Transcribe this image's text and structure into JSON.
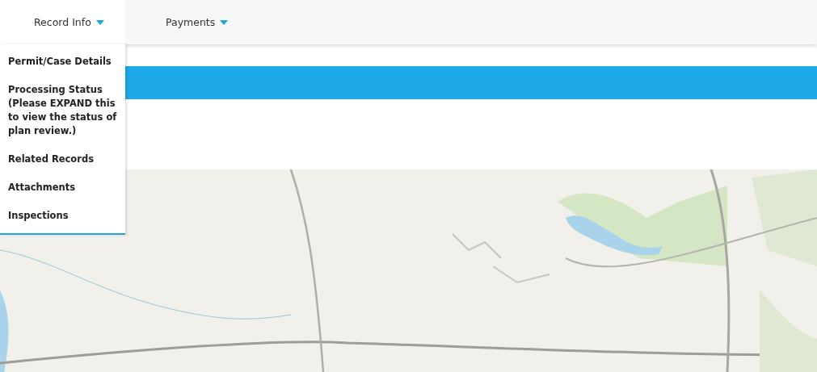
{
  "nav": [
    {
      "label": "Record Info",
      "expanded": true
    },
    {
      "label": "Payments",
      "expanded": false
    }
  ],
  "menu": [
    "Permit/Case Details",
    "Processing Status (Please EXPAND this to view the status of plan review.)",
    "Related Records",
    "Attachments",
    "Inspections"
  ]
}
